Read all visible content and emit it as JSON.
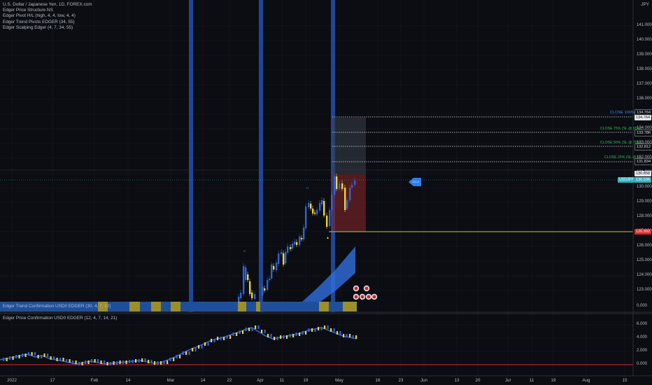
{
  "symbol_title": "U.S. Dollar / Japanese Yen, 1D, FOREX.com",
  "currency": "JPY",
  "indicators": [
    "Edger Price Structure NS",
    "Edger Pivot H/L (high, 4, 4, low, 4, 4)",
    "Edger Trend Pivots EDGER (34, 55)",
    "Edger Scalping Edger (4, 7, 34, 55)"
  ],
  "panel2_label": "Edger Trend Confirmation USD0 EDGER (30, 4, 7, 12)",
  "panel3_label": "Edger Price Confirmation USD0 EDGER (12, 4, 7, 14, 21)",
  "price_axis": [
    "141.000",
    "140.000",
    "139.000",
    "138.000",
    "137.000",
    "136.000",
    "135.000",
    "134.000",
    "133.000",
    "132.000",
    "131.000",
    "130.000",
    "129.000",
    "128.000",
    "127.000",
    "126.000",
    "125.000",
    "124.000",
    "123.000"
  ],
  "panel2_axis": [
    "0.000"
  ],
  "panel3_axis": [
    "6.000",
    "4.000",
    "2.000",
    "0.000"
  ],
  "time_axis": [
    "2022",
    "17",
    "Feb",
    "14",
    "Mar",
    "14",
    "22",
    "Apr",
    "11",
    "19",
    "May",
    "16",
    "23",
    "Jun",
    "13",
    "20",
    "Jul",
    "11",
    "19",
    "Aug",
    "15"
  ],
  "levels": [
    {
      "label": "CLOSE 100%",
      "price_label": "134.764",
      "color": "#3c8ce6"
    },
    {
      "label": "CLOSE 75% (SL @ 95%)",
      "price_label": "133.786",
      "color": "#2fbd4d"
    },
    {
      "label": "CLOSE 50% (SL @ 75%)",
      "price_label": "132.812",
      "color": "#2fbd4d"
    },
    {
      "label": "CLOSE 25% (SL @ 0)",
      "price_label": "131.834",
      "color": "#2fbd4d"
    }
  ],
  "last_price_box": "130.858",
  "usdjpy_badge": "USDJPY",
  "usdjpy_price": "130.536",
  "stop_price": "126.992",
  "entry_badge_text": "130.5",
  "colors": {
    "bull": "#2f63d8",
    "bear": "#f2d23a",
    "zone": "#2f6fe0",
    "stop": "#f2423f",
    "target": "#4a4e58"
  }
}
